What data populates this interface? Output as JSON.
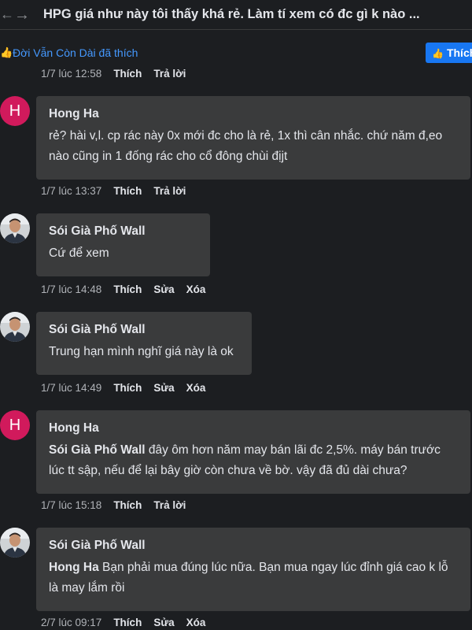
{
  "header": {
    "title": "HPG giá như này tôi thấy khá rẻ. Làm tí xem có đc gì k nào ..."
  },
  "likebar": {
    "liked_text": "Đời Vẫn Còn Dài đã thích",
    "like_button": "Thích"
  },
  "top_meta": {
    "time": "1/7 lúc 12:58",
    "like": "Thích",
    "reply": "Trả lời"
  },
  "comments": [
    {
      "avatar_letter": "H",
      "author": "Hong Ha",
      "tag": "",
      "text": "rẻ? hài v,l. cp rác này 0x mới đc cho là rẻ, 1x thì cân nhắc. chứ năm đ,eo nào cũng in 1 đống rác cho cổ đông chùi địjt",
      "time": "1/7 lúc 13:37",
      "actions": [
        "Thích",
        "Trả lời"
      ]
    },
    {
      "author": "Sói Già Phố Wall",
      "tag": "",
      "text": "Cứ để xem",
      "time": "1/7 lúc 14:48",
      "actions": [
        "Thích",
        "Sửa",
        "Xóa"
      ]
    },
    {
      "author": "Sói Già Phố Wall",
      "tag": "",
      "text": "Trung hạn mình nghĩ giá này là ok",
      "time": "1/7 lúc 14:49",
      "actions": [
        "Thích",
        "Sửa",
        "Xóa"
      ]
    },
    {
      "avatar_letter": "H",
      "author": "Hong Ha",
      "tag": "Sói Già Phố Wall",
      "text": "đây ôm hơn năm may bán lãi đc 2,5%. máy bán trước lúc tt sập, nếu để lại bây giờ còn chưa về bờ. vậy đã đủ dài chưa?",
      "time": "1/7 lúc 15:18",
      "actions": [
        "Thích",
        "Trả lời"
      ]
    },
    {
      "author": "Sói Già Phố Wall",
      "tag": "Hong Ha",
      "text": "Bạn phải mua đúng lúc nữa. Bạn mua ngay lúc đỉnh giá cao k lỗ là may lắm rồi",
      "time": "2/7 lúc 09:17",
      "actions": [
        "Thích",
        "Sửa",
        "Xóa"
      ]
    }
  ]
}
